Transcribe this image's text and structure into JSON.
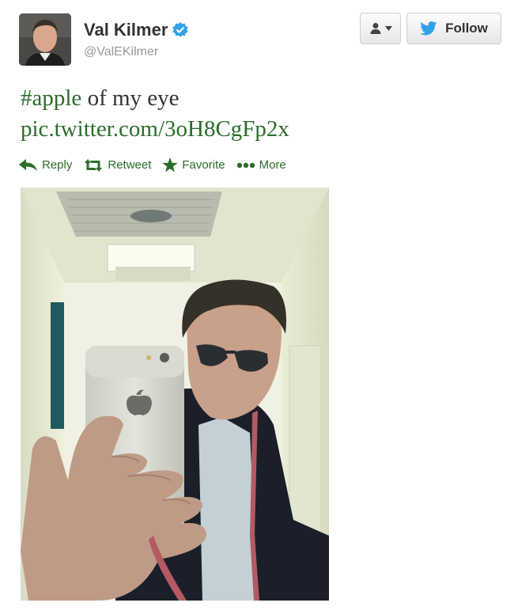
{
  "user": {
    "name": "Val Kilmer",
    "handle": "@ValEKilmer"
  },
  "buttons": {
    "follow_label": "Follow"
  },
  "tweet": {
    "hashtag": "#apple",
    "text_rest": " of my eye",
    "pic_link": "pic.twitter.com/3oH8CgFp2x"
  },
  "actions": {
    "reply": "Reply",
    "retweet": "Retweet",
    "favorite": "Favorite",
    "more": "More"
  },
  "icons": [
    "verified-badge-icon",
    "user-menu-icon",
    "twitter-bird-icon",
    "reply-icon",
    "retweet-icon",
    "star-icon",
    "more-dots-icon"
  ],
  "colors": {
    "link_green": "#2b6c2b",
    "twitter_blue": "#1da1f2"
  }
}
